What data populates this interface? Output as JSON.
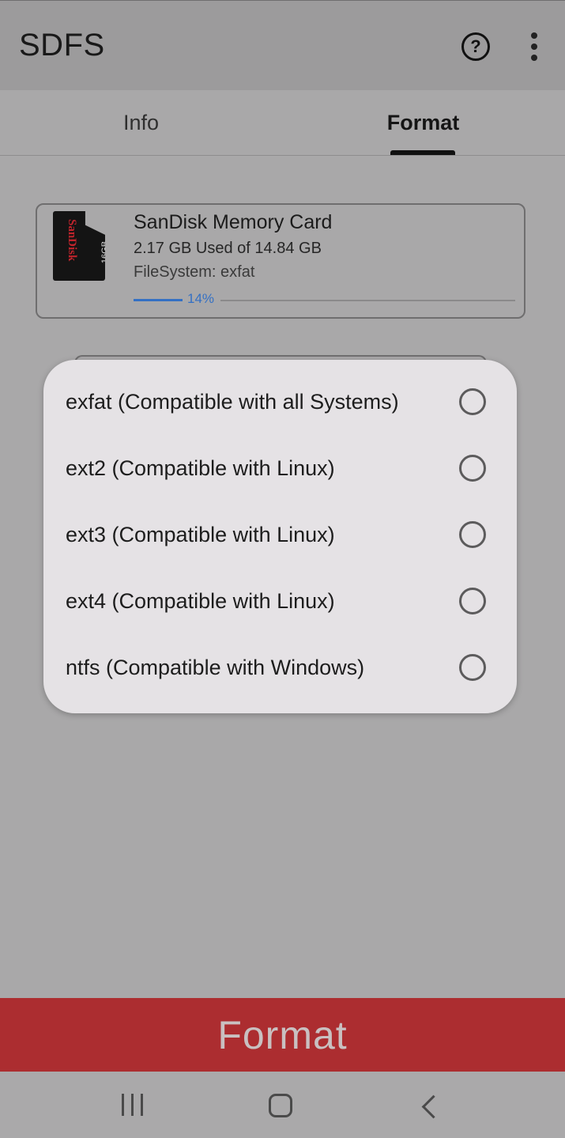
{
  "app_bar": {
    "title": "SDFS",
    "help_icon": "help-circle-icon",
    "help_glyph": "?",
    "more_icon": "more-vert-icon"
  },
  "tabs": [
    {
      "label": "Info",
      "selected": false
    },
    {
      "label": "Format",
      "selected": true
    }
  ],
  "card": {
    "icon": "sd-card-icon",
    "icon_brand": "SanDisk",
    "icon_capacity": "16GB",
    "title": "SanDisk Memory Card",
    "usage": "2.17 GB Used of 14.84 GB",
    "filesystem": "FileSystem: exfat",
    "progress_label": "14%",
    "progress_fraction": 0.14
  },
  "dialog": {
    "options": [
      {
        "label": "exfat (Compatible with all Systems)",
        "selected": false
      },
      {
        "label": "ext2 (Compatible with Linux)",
        "selected": false
      },
      {
        "label": "ext3 (Compatible with Linux)",
        "selected": false
      },
      {
        "label": "ext4 (Compatible with Linux)",
        "selected": false
      },
      {
        "label": "ntfs (Compatible with Windows)",
        "selected": false
      }
    ]
  },
  "format_button": {
    "label": "Format"
  },
  "nav_bar": {
    "recents_icon": "recents-icon",
    "home_icon": "home-icon",
    "back_icon": "back-icon"
  },
  "colors": {
    "accent": "#3470c4",
    "format_button": "#ac2d30",
    "dialog_bg": "#e5e2e5",
    "scrim_bg": "#a9a8a9"
  }
}
